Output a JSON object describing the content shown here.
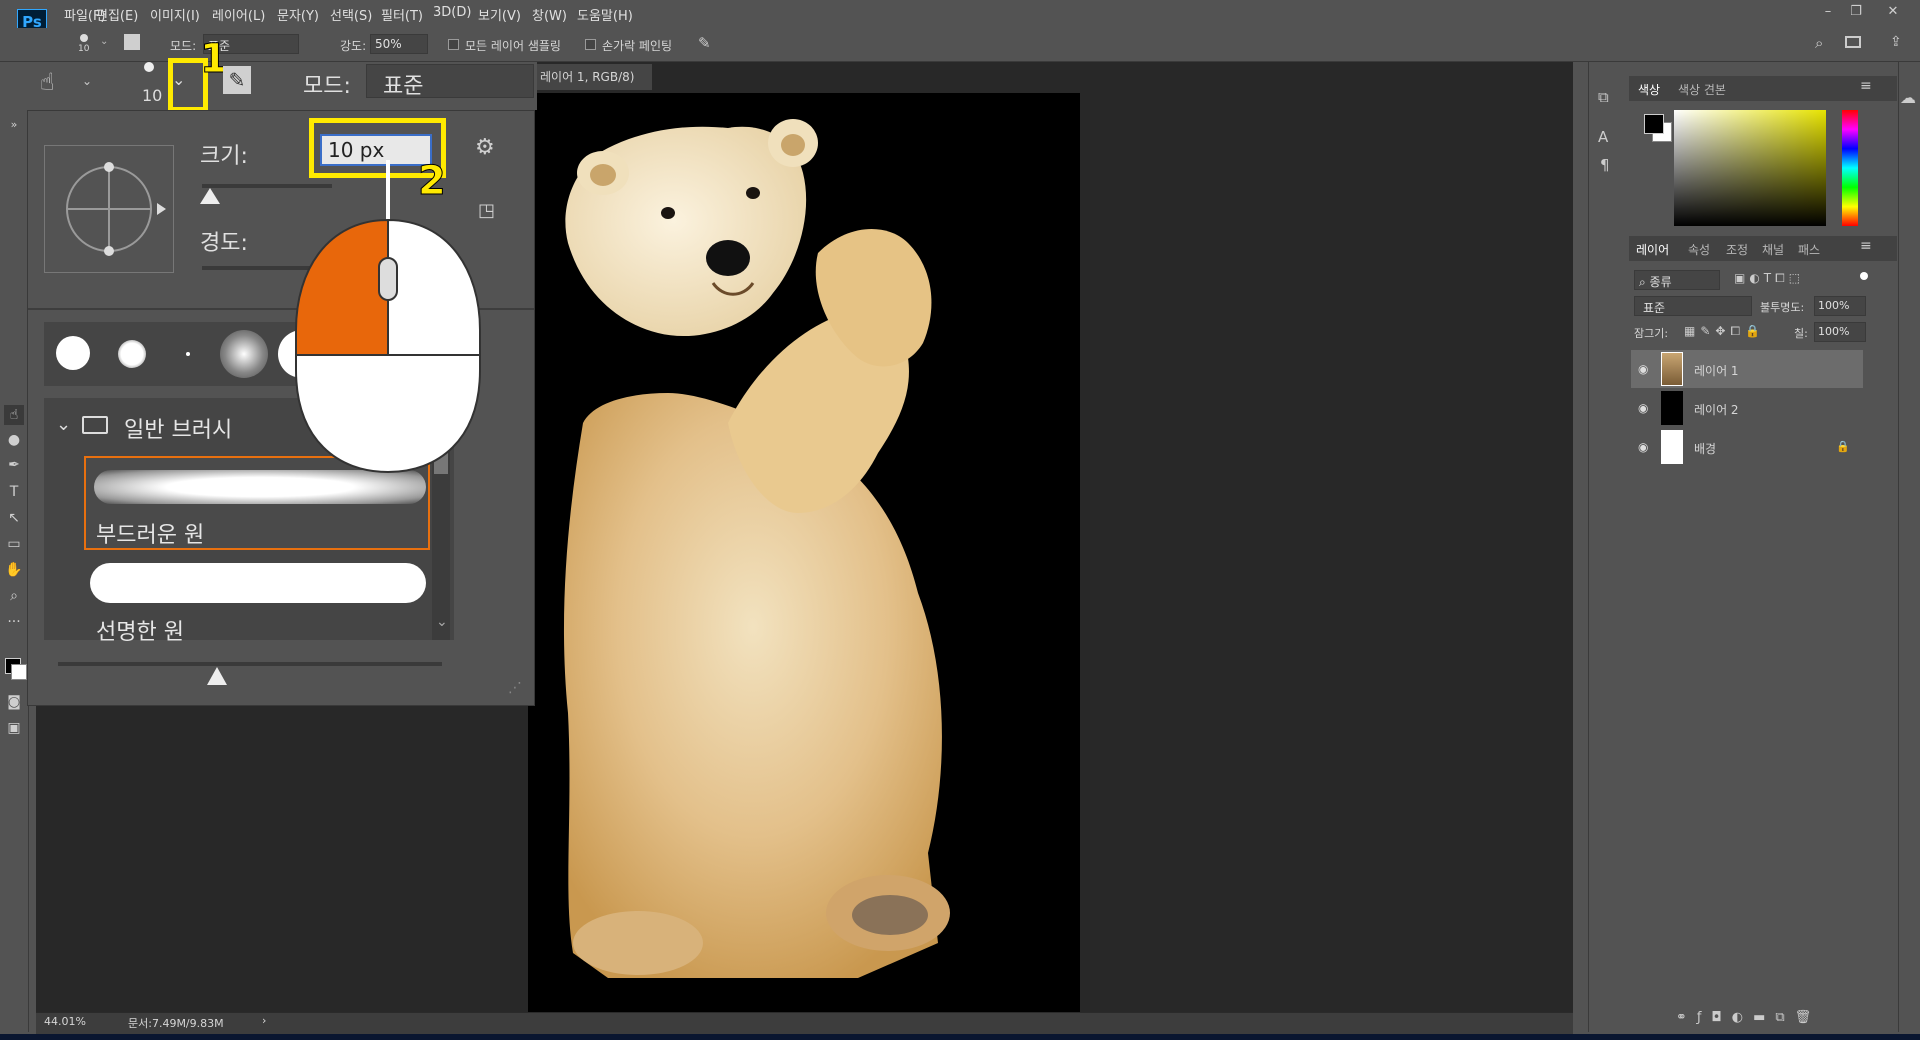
{
  "app": {
    "logo": "Ps"
  },
  "menubar": {
    "items": [
      "파일(F)",
      "편집(E)",
      "이미지(I)",
      "레이어(L)",
      "문자(Y)",
      "선택(S)",
      "필터(T)",
      "3D(D)",
      "보기(V)",
      "창(W)",
      "도움말(H)"
    ],
    "window_buttons": [
      "–",
      "❐",
      "✕"
    ]
  },
  "options_bar": {
    "brush_size": "10",
    "mode_label": "모드:",
    "mode_value": "표준",
    "strength_label": "강도:",
    "strength_value": "50%",
    "sample_all_label": "모든 레이어 샘플링",
    "finger_paint_label": "손가락 페인팅"
  },
  "zoomed_bar": {
    "brush_size": "10",
    "mode_label": "모드:",
    "mode_value": "표준"
  },
  "brush_popup": {
    "size_label": "크기:",
    "size_value": "10 px",
    "hardness_label": "경도:",
    "group_label": "일반 브러시",
    "brushes": [
      "부드러운 원",
      "선명한 원"
    ]
  },
  "annotations": {
    "step1": "1",
    "step2": "2",
    "color": "#ffea00"
  },
  "document": {
    "tab_title": "레이어 1, RGB/8) *",
    "zoom": "44.01%",
    "doc_info": "문서:7.49M/9.83M"
  },
  "color_panel": {
    "tabs": [
      "색상",
      "색상 견본"
    ]
  },
  "layers_panel": {
    "tabs": [
      "레이어",
      "속성",
      "조정",
      "채널",
      "패스"
    ],
    "kind_filter": "종류",
    "blend_mode": "표준",
    "opacity_label": "불투명도:",
    "opacity_value": "100%",
    "lock_label": "잠그기:",
    "fill_label": "칠:",
    "fill_value": "100%",
    "layers": [
      {
        "name": "레이어 1",
        "selected": true
      },
      {
        "name": "레이어 2",
        "selected": false
      },
      {
        "name": "배경",
        "selected": false,
        "locked": true
      }
    ]
  },
  "colors": {
    "accent": "#ffea00",
    "brush_selected_border": "#e8700f",
    "mouse_button": "#e8670b"
  }
}
